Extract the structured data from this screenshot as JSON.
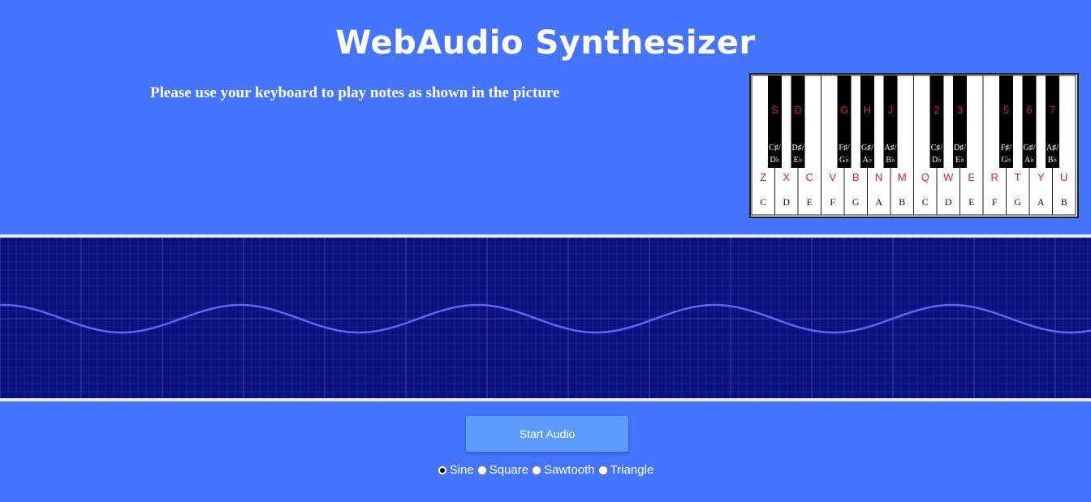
{
  "title": "WebAudio Synthesizer",
  "instructions": "Please use your keyboard to play notes as shown in the picture",
  "keyboard_picture": {
    "octaves": [
      {
        "black_keys": [
          {
            "shortcut": "S",
            "note_top": "C♯/",
            "note_bottom": "D♭"
          },
          {
            "shortcut": "D",
            "note_top": "D♯/",
            "note_bottom": "E♭"
          },
          {
            "shortcut": "G",
            "note_top": "F♯/",
            "note_bottom": "G♭"
          },
          {
            "shortcut": "H",
            "note_top": "G♯/",
            "note_bottom": "A♭"
          },
          {
            "shortcut": "J",
            "note_top": "A♯/",
            "note_bottom": "B♭"
          }
        ],
        "white_keys": [
          {
            "shortcut": "Z",
            "note": "C"
          },
          {
            "shortcut": "X",
            "note": "D"
          },
          {
            "shortcut": "C",
            "note": "E"
          },
          {
            "shortcut": "V",
            "note": "F"
          },
          {
            "shortcut": "B",
            "note": "G"
          },
          {
            "shortcut": "N",
            "note": "A"
          },
          {
            "shortcut": "M",
            "note": "B"
          }
        ]
      },
      {
        "black_keys": [
          {
            "shortcut": "2",
            "note_top": "C♯/",
            "note_bottom": "D♭"
          },
          {
            "shortcut": "3",
            "note_top": "D♯/",
            "note_bottom": "E♭"
          },
          {
            "shortcut": "5",
            "note_top": "F♯/",
            "note_bottom": "G♭"
          },
          {
            "shortcut": "6",
            "note_top": "G♯/",
            "note_bottom": "A♭"
          },
          {
            "shortcut": "7",
            "note_top": "A♯/",
            "note_bottom": "B♭"
          }
        ],
        "white_keys": [
          {
            "shortcut": "Q",
            "note": "C"
          },
          {
            "shortcut": "W",
            "note": "D"
          },
          {
            "shortcut": "E",
            "note": "E"
          },
          {
            "shortcut": "R",
            "note": "F"
          },
          {
            "shortcut": "T",
            "note": "G"
          },
          {
            "shortcut": "Y",
            "note": "A"
          },
          {
            "shortcut": "U",
            "note": "B"
          }
        ]
      }
    ]
  },
  "oscilloscope": {
    "waveform": "sine",
    "cycles_visible": 4.6,
    "background_color": "#0a1280",
    "grid_color": "#3a48a8",
    "wave_color": "#5a66f4"
  },
  "start_button": {
    "label": "Start Audio"
  },
  "wave_types": {
    "selected": "Sine",
    "options": [
      "Sine",
      "Square",
      "Sawtooth",
      "Triangle"
    ]
  },
  "colors": {
    "page_background": "#4575fe",
    "button_background": "#5b9cfe",
    "shortcut_label": "#e02020"
  }
}
